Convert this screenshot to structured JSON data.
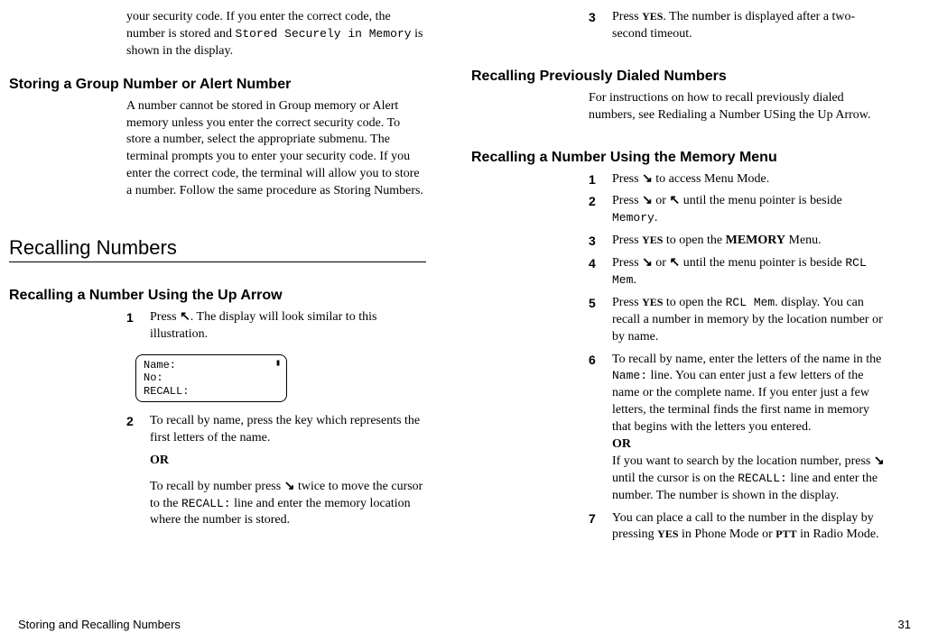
{
  "left": {
    "intro": {
      "p1a": "your security code.  If you enter the correct code, the number is stored and ",
      "p1b": "Stored Securely in Memory",
      "p1c": " is shown in the display."
    },
    "sec1": {
      "title": "Storing a Group Number or Alert Number",
      "body": "A number cannot be stored in Group memory or Alert memory unless you enter the correct security code. To store a number, select the appropriate submenu. The terminal prompts  you to enter your security code. If you enter the correct code, the terminal will allow you to store a number. Follow the same procedure as Storing Numbers."
    },
    "sec2": {
      "title": "Recalling Numbers"
    },
    "sec3": {
      "title": "Recalling a Number Using the Up Arrow",
      "step1": {
        "num": "1",
        "a": "Press ",
        "b": ".  The display will look similar to this illustration."
      },
      "display": {
        "l1": "Name:",
        "l2": "No:",
        "l3": "RECALL:"
      },
      "step2": {
        "num": "2",
        "a": "To recall by name, press the key which represents the first letters of the name.",
        "or": "OR",
        "b1": "To recall by number press ",
        "b2": " twice to move the cursor to the ",
        "b3": "RECALL:",
        "b4": " line and enter the memory location where the number is stored."
      }
    }
  },
  "right": {
    "step3": {
      "num": "3",
      "a": "Press ",
      "yes": "YES",
      "b": ". The number is displayed after a two-second timeout."
    },
    "sec4": {
      "title": "Recalling Previously Dialed Numbers",
      "body": "For instructions on how to recall previously dialed numbers, see Redialing a Number USing the Up Arrow."
    },
    "sec5": {
      "title": "Recalling a Number Using the Memory Menu",
      "s1": {
        "num": "1",
        "a": "Press ",
        "b": " to access Menu Mode."
      },
      "s2": {
        "num": "2",
        "a": "Press ",
        "b": " or ",
        "c": " until the menu pointer is beside ",
        "d": "Memory",
        "e": "."
      },
      "s3": {
        "num": "3",
        "a": "Press ",
        "yes": "YES",
        "b": " to open the ",
        "c": "MEMORY",
        "d": " Menu."
      },
      "s4": {
        "num": "4",
        "a": "Press ",
        "b": " or ",
        "c": " until the menu pointer is beside ",
        "d": "RCL Mem",
        "e": "."
      },
      "s5": {
        "num": "5",
        "a": "Press ",
        "yes": "YES",
        "b": " to open the ",
        "c": "RCL Mem",
        "d": ". display.  You can recall a number in memory by the location number or by name."
      },
      "s6": {
        "num": "6",
        "a": "To recall by name, enter the letters of the name in the ",
        "b": "Name:",
        "c": " line. You can enter just a few letters of the name or the complete name.  If you enter just a few letters, the terminal finds the first name in memory that begins with the letters you entered.",
        "or": "OR",
        "d": "If you want to search by the location number, press ",
        "e": " until the cursor is on the ",
        "f": "RECALL:",
        "g": " line and enter the number.  The number is shown in the display."
      },
      "s7": {
        "num": "7",
        "a": "You can place a call to the number in the display by pressing ",
        "yes": "YES",
        "b": " in Phone Mode or ",
        "ptt": "PTT",
        "c": " in Radio Mode."
      }
    }
  },
  "footer": {
    "left": "Storing and Recalling Numbers",
    "right": "31"
  },
  "arrows": {
    "up": "↖",
    "down": "↘"
  }
}
